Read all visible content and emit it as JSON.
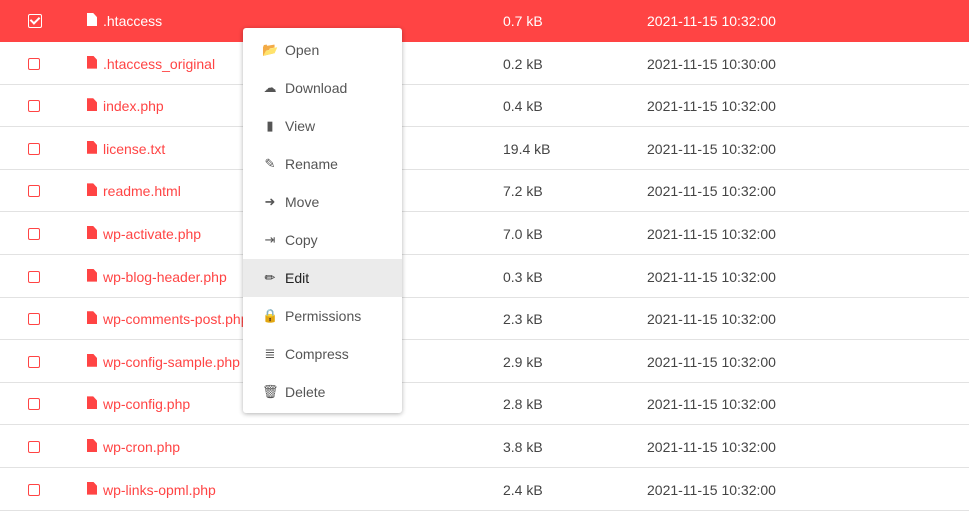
{
  "files": [
    {
      "name": ".htaccess",
      "size": "0.7 kB",
      "date": "2021-11-15 10:32:00",
      "selected": true
    },
    {
      "name": ".htaccess_original",
      "size": "0.2 kB",
      "date": "2021-11-15 10:30:00"
    },
    {
      "name": "index.php",
      "size": "0.4 kB",
      "date": "2021-11-15 10:32:00"
    },
    {
      "name": "license.txt",
      "size": "19.4 kB",
      "date": "2021-11-15 10:32:00"
    },
    {
      "name": "readme.html",
      "size": "7.2 kB",
      "date": "2021-11-15 10:32:00"
    },
    {
      "name": "wp-activate.php",
      "size": "7.0 kB",
      "date": "2021-11-15 10:32:00"
    },
    {
      "name": "wp-blog-header.php",
      "size": "0.3 kB",
      "date": "2021-11-15 10:32:00"
    },
    {
      "name": "wp-comments-post.php",
      "size": "2.3 kB",
      "date": "2021-11-15 10:32:00"
    },
    {
      "name": "wp-config-sample.php",
      "size": "2.9 kB",
      "date": "2021-11-15 10:32:00"
    },
    {
      "name": "wp-config.php",
      "size": "2.8 kB",
      "date": "2021-11-15 10:32:00"
    },
    {
      "name": "wp-cron.php",
      "size": "3.8 kB",
      "date": "2021-11-15 10:32:00"
    },
    {
      "name": "wp-links-opml.php",
      "size": "2.4 kB",
      "date": "2021-11-15 10:32:00"
    }
  ],
  "context_menu": [
    {
      "label": "Open",
      "icon": "folder-open-icon"
    },
    {
      "label": "Download",
      "icon": "cloud-download-icon"
    },
    {
      "label": "View",
      "icon": "file-icon"
    },
    {
      "label": "Rename",
      "icon": "edit-icon"
    },
    {
      "label": "Move",
      "icon": "arrow-right-icon"
    },
    {
      "label": "Copy",
      "icon": "copy-icon"
    },
    {
      "label": "Edit",
      "icon": "pencil-icon",
      "highlighted": true
    },
    {
      "label": "Permissions",
      "icon": "lock-icon"
    },
    {
      "label": "Compress",
      "icon": "archive-icon"
    },
    {
      "label": "Delete",
      "icon": "trash-icon"
    }
  ],
  "colors": {
    "accent": "#ff4444",
    "highlight": "#ebebeb"
  }
}
